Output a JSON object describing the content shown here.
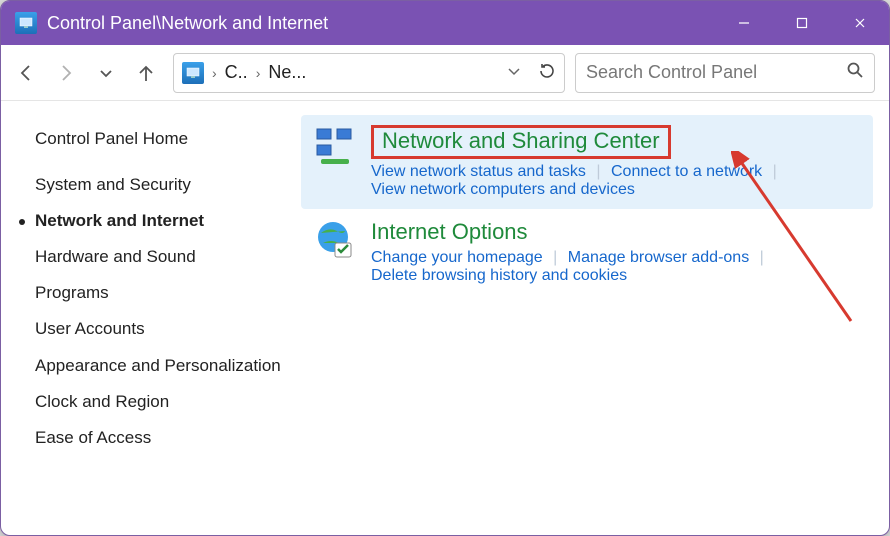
{
  "window": {
    "title": "Control Panel\\Network and Internet"
  },
  "address": {
    "seg1": "C..",
    "seg2": "Ne..."
  },
  "search": {
    "placeholder": "Search Control Panel"
  },
  "sidebar": {
    "items": [
      {
        "label": "Control Panel Home",
        "active": false
      },
      {
        "label": "System and Security",
        "active": false
      },
      {
        "label": "Network and Internet",
        "active": true
      },
      {
        "label": "Hardware and Sound",
        "active": false
      },
      {
        "label": "Programs",
        "active": false
      },
      {
        "label": "User Accounts",
        "active": false
      },
      {
        "label": "Appearance and Personalization",
        "active": false
      },
      {
        "label": "Clock and Region",
        "active": false
      },
      {
        "label": "Ease of Access",
        "active": false
      }
    ]
  },
  "categories": [
    {
      "title": "Network and Sharing Center",
      "highlighted": true,
      "links": [
        "View network status and tasks",
        "Connect to a network",
        "View network computers and devices"
      ]
    },
    {
      "title": "Internet Options",
      "highlighted": false,
      "links": [
        "Change your homepage",
        "Manage browser add-ons",
        "Delete browsing history and cookies"
      ]
    }
  ]
}
